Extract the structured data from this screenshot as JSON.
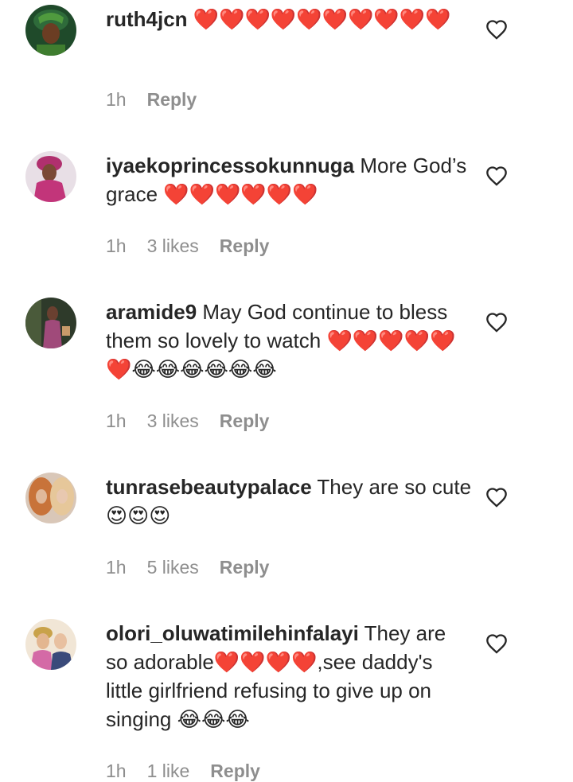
{
  "comments": [
    {
      "username": "ruth4jcn",
      "text": " ❤️❤️❤️❤️❤️❤️❤️❤️❤️❤️",
      "time": "1h",
      "likes": "",
      "reply": "Reply"
    },
    {
      "username": "iyaekoprincessokunnuga",
      "text": " More God’s grace ❤️❤️❤️❤️❤️❤️",
      "time": "1h",
      "likes": "3 likes",
      "reply": "Reply"
    },
    {
      "username": "aramide9",
      "text": " May God continue to bless them so lovely to watch ❤️❤️❤️❤️❤️❤️😂😂😂😂😂😂",
      "time": "1h",
      "likes": "3 likes",
      "reply": "Reply"
    },
    {
      "username": "tunrasebeautypalace",
      "text": " They are so cute😍😍😍",
      "time": "1h",
      "likes": "5 likes",
      "reply": "Reply"
    },
    {
      "username": "olori_oluwatimilehinfalayi",
      "text": " They are so adorable❤️❤️❤️❤️,see daddy's little girlfriend refusing to give up on singing 😂😂😂",
      "time": "1h",
      "likes": "1 like",
      "reply": "Reply"
    }
  ],
  "icons": {
    "like": "heart-outline-icon"
  }
}
